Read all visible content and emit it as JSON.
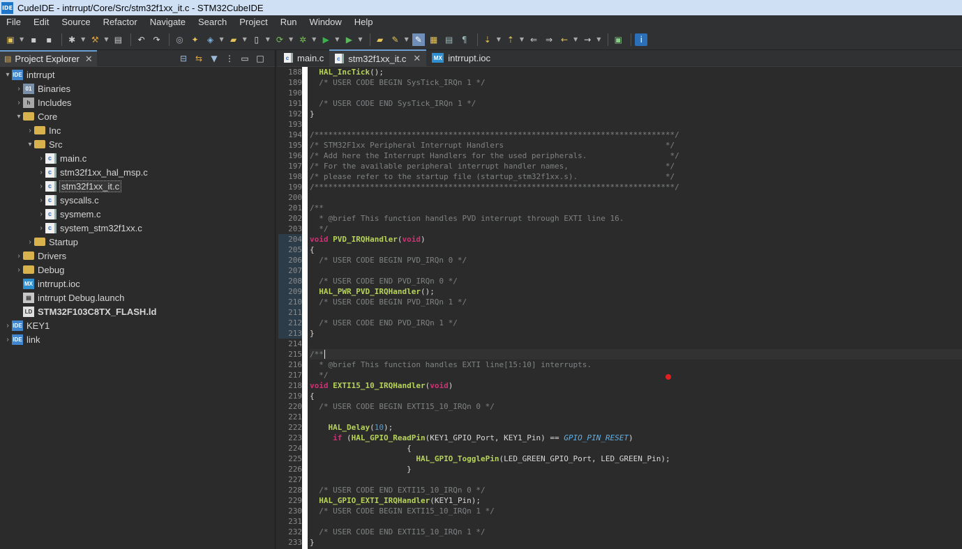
{
  "window": {
    "app_icon": "IDE",
    "title": "CudeIDE - intrrupt/Core/Src/stm32f1xx_it.c - STM32CubeIDE"
  },
  "menu": [
    "File",
    "Edit",
    "Source",
    "Refactor",
    "Navigate",
    "Search",
    "Project",
    "Run",
    "Window",
    "Help"
  ],
  "project_explorer": {
    "tab_label": "Project Explorer",
    "tree": [
      {
        "depth": 0,
        "arrow": "▾",
        "icon": "proj",
        "icon_text": "IDE",
        "label": "intrrupt"
      },
      {
        "depth": 1,
        "arrow": "›",
        "icon": "bin",
        "icon_text": "01",
        "label": "Binaries"
      },
      {
        "depth": 1,
        "arrow": "›",
        "icon": "inc",
        "icon_text": "h",
        "label": "Includes"
      },
      {
        "depth": 1,
        "arrow": "▾",
        "icon": "folder",
        "icon_text": "",
        "label": "Core"
      },
      {
        "depth": 2,
        "arrow": "›",
        "icon": "folder",
        "icon_text": "",
        "label": "Inc"
      },
      {
        "depth": 2,
        "arrow": "▾",
        "icon": "folder",
        "icon_text": "",
        "label": "Src"
      },
      {
        "depth": 3,
        "arrow": "›",
        "icon": "cfile",
        "icon_text": "c",
        "label": "main.c"
      },
      {
        "depth": 3,
        "arrow": "›",
        "icon": "cfile",
        "icon_text": "c",
        "label": "stm32f1xx_hal_msp.c"
      },
      {
        "depth": 3,
        "arrow": "›",
        "icon": "cfile",
        "icon_text": "c",
        "label": "stm32f1xx_it.c",
        "selected": true
      },
      {
        "depth": 3,
        "arrow": "›",
        "icon": "cfile",
        "icon_text": "c",
        "label": "syscalls.c"
      },
      {
        "depth": 3,
        "arrow": "›",
        "icon": "cfile",
        "icon_text": "c",
        "label": "sysmem.c"
      },
      {
        "depth": 3,
        "arrow": "›",
        "icon": "cfile",
        "icon_text": "c",
        "label": "system_stm32f1xx.c"
      },
      {
        "depth": 2,
        "arrow": "›",
        "icon": "folder",
        "icon_text": "",
        "label": "Startup"
      },
      {
        "depth": 1,
        "arrow": "›",
        "icon": "folder",
        "icon_text": "",
        "label": "Drivers"
      },
      {
        "depth": 1,
        "arrow": "›",
        "icon": "folder",
        "icon_text": "",
        "label": "Debug"
      },
      {
        "depth": 1,
        "arrow": "",
        "icon": "mx",
        "icon_text": "MX",
        "label": "intrrupt.ioc"
      },
      {
        "depth": 1,
        "arrow": "",
        "icon": "launch",
        "icon_text": "▤",
        "label": "intrrupt Debug.launch"
      },
      {
        "depth": 1,
        "arrow": "",
        "icon": "ld",
        "icon_text": "LD",
        "label": "STM32F103C8TX_FLASH.ld",
        "bold": true
      },
      {
        "depth": 0,
        "arrow": "›",
        "icon": "proj",
        "icon_text": "IDE",
        "label": "KEY1"
      },
      {
        "depth": 0,
        "arrow": "›",
        "icon": "proj",
        "icon_text": "IDE",
        "label": "link"
      }
    ]
  },
  "editor": {
    "tabs": [
      {
        "label": "main.c",
        "icon": "cfile",
        "icon_text": "c",
        "active": false
      },
      {
        "label": "stm32f1xx_it.c",
        "icon": "cfile",
        "icon_text": "c",
        "active": true,
        "close": "✕"
      },
      {
        "label": "intrrupt.ioc",
        "icon": "mx",
        "icon_text": "MX",
        "active": false
      }
    ],
    "lines": [
      {
        "n": "188",
        "t": [
          [
            "  ",
            ""
          ],
          [
            "HAL_IncTick",
            "fn"
          ],
          [
            "();",
            ""
          ]
        ]
      },
      {
        "n": "189",
        "t": [
          [
            "  /* USER CODE BEGIN SysTick_IRQn 1 */",
            "cm"
          ]
        ]
      },
      {
        "n": "190",
        "t": []
      },
      {
        "n": "191",
        "t": [
          [
            "  /* USER CODE END SysTick_IRQn 1 */",
            "cm"
          ]
        ]
      },
      {
        "n": "192",
        "t": [
          [
            "}",
            ""
          ]
        ]
      },
      {
        "n": "193",
        "t": []
      },
      {
        "n": "194",
        "fold": "⊖",
        "t": [
          [
            "/******************************************************************************/",
            "cm"
          ]
        ]
      },
      {
        "n": "195",
        "t": [
          [
            "/* STM32F1xx Peripheral Interrupt Handlers                                   */",
            "cm"
          ]
        ]
      },
      {
        "n": "196",
        "t": [
          [
            "/* Add here the Interrupt Handlers for the used peripherals.                  */",
            "cm"
          ]
        ]
      },
      {
        "n": "197",
        "t": [
          [
            "/* For the available peripheral interrupt handler names,                     */",
            "cm"
          ]
        ]
      },
      {
        "n": "198",
        "t": [
          [
            "/* please refer to the startup file (startup_stm32f1xx.s).                   */",
            "cm"
          ]
        ]
      },
      {
        "n": "199",
        "t": [
          [
            "/******************************************************************************/",
            "cm"
          ]
        ]
      },
      {
        "n": "200",
        "t": []
      },
      {
        "n": "201",
        "fold": "⊖",
        "t": [
          [
            "/**",
            "cm"
          ]
        ]
      },
      {
        "n": "202",
        "t": [
          [
            "  * @brief This function handles PVD interrupt through EXTI line 16.",
            "cm"
          ]
        ]
      },
      {
        "n": "203",
        "t": [
          [
            "  */",
            "cm"
          ]
        ]
      },
      {
        "n": "204",
        "fold": "⊖",
        "mark": true,
        "t": [
          [
            "void",
            "kw"
          ],
          [
            " ",
            ""
          ],
          [
            "PVD_IRQHandler",
            "fn"
          ],
          [
            "(",
            ""
          ],
          [
            "void",
            "kw"
          ],
          [
            ")",
            ""
          ]
        ]
      },
      {
        "n": "205",
        "mark": true,
        "t": [
          [
            "{",
            ""
          ]
        ]
      },
      {
        "n": "206",
        "mark": true,
        "t": [
          [
            "  /* USER CODE BEGIN PVD_IRQn 0 */",
            "cm"
          ]
        ]
      },
      {
        "n": "207",
        "mark": true,
        "t": []
      },
      {
        "n": "208",
        "mark": true,
        "t": [
          [
            "  /* USER CODE END PVD_IRQn 0 */",
            "cm"
          ]
        ]
      },
      {
        "n": "209",
        "mark": true,
        "t": [
          [
            "  ",
            ""
          ],
          [
            "HAL_PWR_PVD_IRQHandler",
            "fn"
          ],
          [
            "();",
            ""
          ]
        ]
      },
      {
        "n": "210",
        "mark": true,
        "t": [
          [
            "  /* USER CODE BEGIN PVD_IRQn 1 */",
            "cm"
          ]
        ]
      },
      {
        "n": "211",
        "mark": true,
        "t": []
      },
      {
        "n": "212",
        "mark": true,
        "t": [
          [
            "  /* USER CODE END PVD_IRQn 1 */",
            "cm"
          ]
        ]
      },
      {
        "n": "213",
        "mark": true,
        "t": [
          [
            "}",
            ""
          ]
        ]
      },
      {
        "n": "214",
        "t": []
      },
      {
        "n": "215",
        "fold": "⊖",
        "cur": true,
        "t": [
          [
            "/**",
            "cm"
          ]
        ]
      },
      {
        "n": "216",
        "t": [
          [
            "  * @brief This function handles EXTI line[15:10] interrupts.",
            "cm"
          ]
        ]
      },
      {
        "n": "217",
        "t": [
          [
            "  */",
            "cm"
          ]
        ]
      },
      {
        "n": "218",
        "fold": "⊖",
        "t": [
          [
            "void",
            "kw"
          ],
          [
            " ",
            ""
          ],
          [
            "EXTI15_10_IRQHandler",
            "fn"
          ],
          [
            "(",
            ""
          ],
          [
            "void",
            "kw"
          ],
          [
            ")",
            ""
          ]
        ]
      },
      {
        "n": "219",
        "t": [
          [
            "{",
            ""
          ]
        ]
      },
      {
        "n": "220",
        "t": [
          [
            "  /* USER CODE BEGIN EXTI15_10_IRQn 0 */",
            "cm"
          ]
        ]
      },
      {
        "n": "221",
        "t": []
      },
      {
        "n": "222",
        "t": [
          [
            "    ",
            ""
          ],
          [
            "HAL_Delay",
            "fn"
          ],
          [
            "(",
            ""
          ],
          [
            "10",
            "num"
          ],
          [
            ");",
            ""
          ]
        ]
      },
      {
        "n": "223",
        "t": [
          [
            "     ",
            ""
          ],
          [
            "if",
            "kw"
          ],
          [
            " (",
            ""
          ],
          [
            "HAL_GPIO_ReadPin",
            "fn"
          ],
          [
            "(KEY1_GPIO_Port, KEY1_Pin) == ",
            ""
          ],
          [
            "GPIO_PIN_RESET",
            "it"
          ],
          [
            ")",
            ""
          ]
        ]
      },
      {
        "n": "224",
        "t": [
          [
            "                     {",
            ""
          ]
        ]
      },
      {
        "n": "225",
        "t": [
          [
            "                       ",
            ""
          ],
          [
            "HAL_GPIO_TogglePin",
            "fn"
          ],
          [
            "(LED_GREEN_GPIO_Port, LED_GREEN_Pin);",
            ""
          ]
        ]
      },
      {
        "n": "226",
        "t": [
          [
            "                     }",
            ""
          ]
        ]
      },
      {
        "n": "227",
        "t": []
      },
      {
        "n": "228",
        "t": [
          [
            "  /* USER CODE END EXTI15_10_IRQn 0 */",
            "cm"
          ]
        ]
      },
      {
        "n": "229",
        "t": [
          [
            "  ",
            ""
          ],
          [
            "HAL_GPIO_EXTI_IRQHandler",
            "fn"
          ],
          [
            "(KEY1_Pin);",
            ""
          ]
        ]
      },
      {
        "n": "230",
        "t": [
          [
            "  /* USER CODE BEGIN EXTI15_10_IRQn 1 */",
            "cm"
          ]
        ]
      },
      {
        "n": "231",
        "t": []
      },
      {
        "n": "232",
        "t": [
          [
            "  /* USER CODE END EXTI15_10_IRQn 1 */",
            "cm"
          ]
        ]
      },
      {
        "n": "233",
        "t": [
          [
            "}",
            ""
          ]
        ]
      }
    ]
  }
}
